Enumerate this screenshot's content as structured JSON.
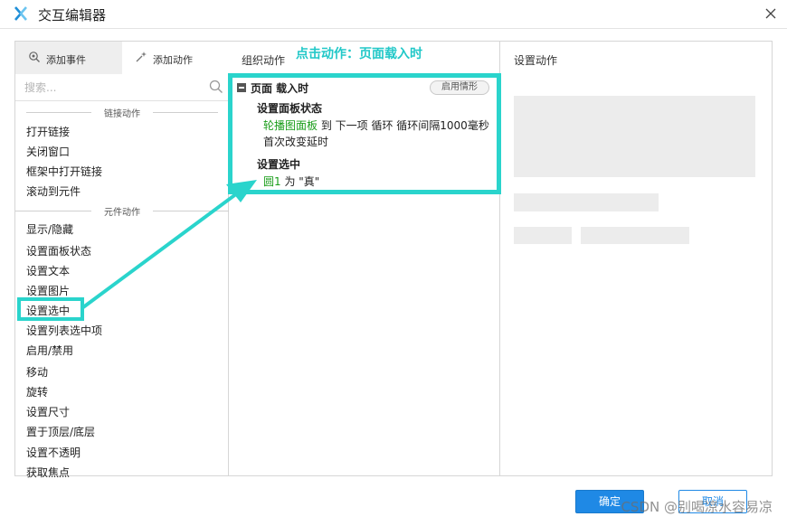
{
  "window": {
    "title": "交互编辑器"
  },
  "left": {
    "tabs": [
      {
        "label": "添加事件",
        "icon": "add-event-icon"
      },
      {
        "label": "添加动作",
        "icon": "add-action-icon"
      }
    ],
    "search_placeholder": "搜索...",
    "groups": {
      "link_header": "链接动作",
      "link_items": [
        "打开链接",
        "关闭窗口",
        "框架中打开链接",
        "滚动到元件"
      ],
      "widget_header": "元件动作",
      "widget_items": [
        "显示/隐藏",
        "设置面板状态",
        "设置文本",
        "设置图片",
        "设置选中",
        "设置列表选中项",
        "启用/禁用",
        "移动",
        "旋转",
        "设置尺寸",
        "置于顶层/底层",
        "设置不透明",
        "获取焦点"
      ]
    }
  },
  "middle": {
    "header": "组织动作",
    "annotation": "点击动作：页面载入时",
    "event": {
      "title": "页面 载入时",
      "condition_button": "启用情形",
      "actions": [
        {
          "name": "设置面板状态",
          "target": "轮播图面板",
          "line1_rest": " 到 下一项 循环 循环间隔1000毫秒",
          "line2": "首次改变延时"
        },
        {
          "name": "设置选中",
          "target": "圆1",
          "line1_rest": " 为 \"真\""
        }
      ]
    }
  },
  "right": {
    "header": "设置动作"
  },
  "footer": {
    "ok_label": "确定",
    "cancel_label": "取消",
    "watermark": "CSDN @别喝凉水容易凉"
  },
  "colors": {
    "accent": "#2ad4cc",
    "primary": "#1f89e5",
    "target_green": "#1a9d1a"
  }
}
